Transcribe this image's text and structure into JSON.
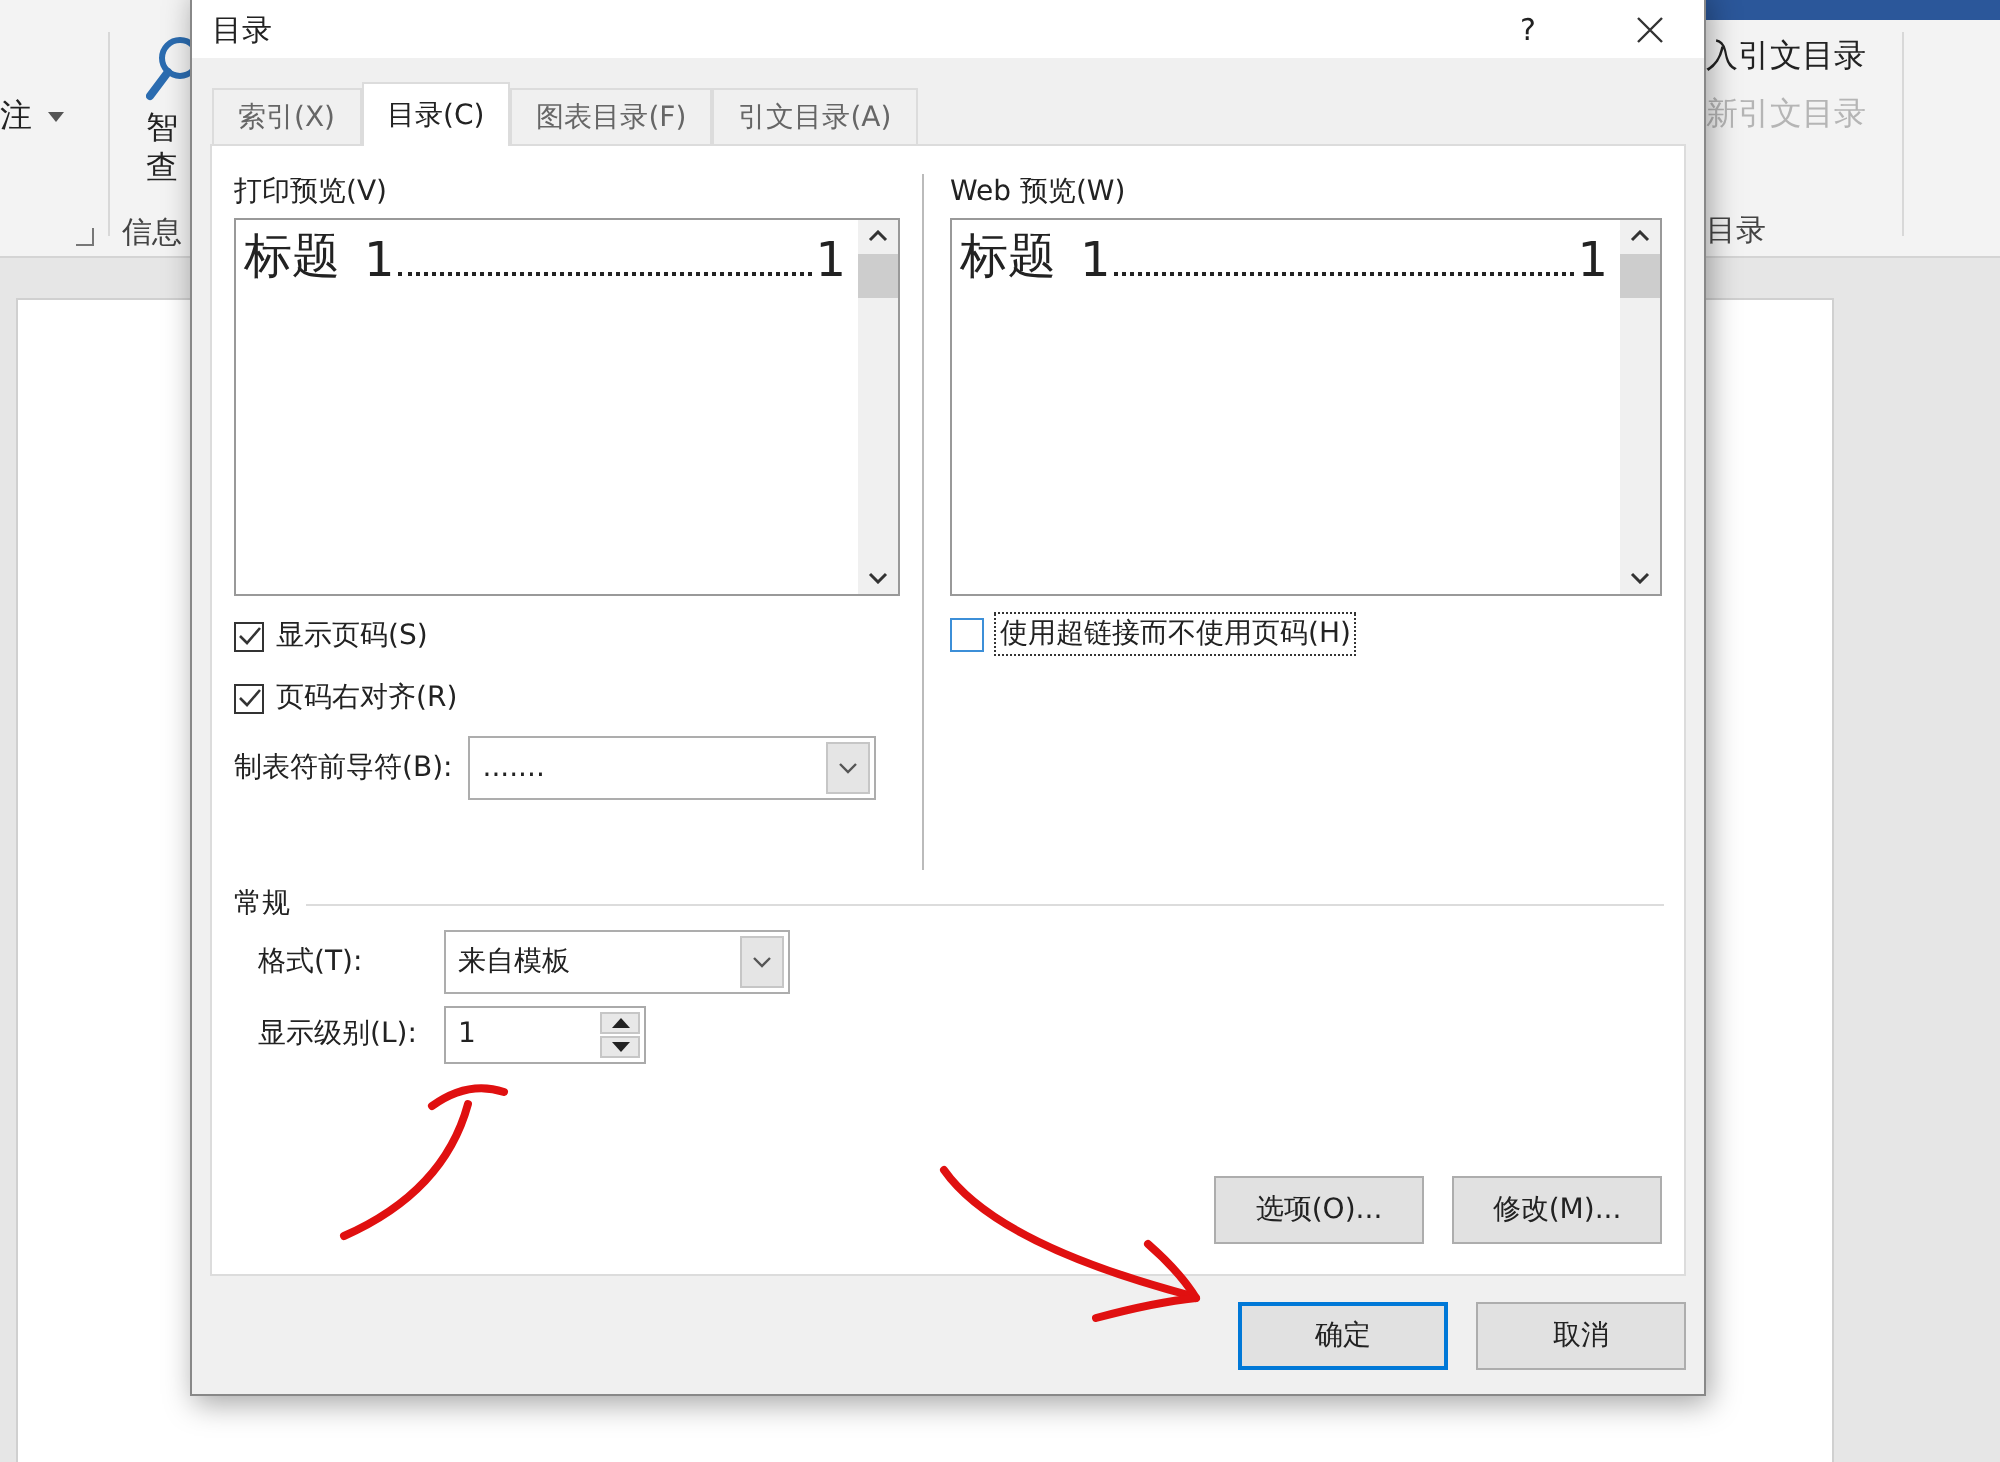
{
  "background_window": {
    "ribbon_left": [
      {
        "label": "注",
        "dropdown": true
      }
    ],
    "ribbon_button": {
      "lines": [
        "智",
        "查"
      ]
    },
    "group_label_left": "信息",
    "ribbon_right": [
      {
        "label": "入引文目录",
        "disabled": false
      },
      {
        "label": "新引文目录",
        "disabled": true
      }
    ],
    "group_label_right": "目录"
  },
  "dialog": {
    "title": "目录",
    "help": "?",
    "tabs": [
      {
        "label": "索引(X)",
        "selected": false
      },
      {
        "label": "目录(C)",
        "selected": true
      },
      {
        "label": "图表目录(F)",
        "selected": false
      },
      {
        "label": "引文目录(A)",
        "selected": false
      }
    ],
    "print_preview": {
      "label": "打印预览(V)",
      "heading": "标题",
      "level": "1",
      "page": "1",
      "leader": true
    },
    "web_preview": {
      "label": "Web 预览(W)",
      "heading": "标题",
      "level": "1",
      "page": "1",
      "leader": true
    },
    "print_options": [
      {
        "label": "显示页码(S)",
        "checked": true
      },
      {
        "label": "页码右对齐(R)",
        "checked": true
      }
    ],
    "tab_leader": {
      "label": "制表符前导符(B):",
      "value": "......."
    },
    "web_options": [
      {
        "label": "使用超链接而不使用页码(H)",
        "checked": false,
        "focused": true
      }
    ],
    "general": {
      "title": "常规",
      "format": {
        "label": "格式(T):",
        "value": "来自模板"
      },
      "levels": {
        "label": "显示级别(L):",
        "value": "1"
      }
    },
    "side_buttons": [
      "选项(O)...",
      "修改(M)..."
    ],
    "footer_buttons": [
      {
        "label": "确定",
        "default": true
      },
      {
        "label": "取消",
        "default": false
      }
    ]
  }
}
